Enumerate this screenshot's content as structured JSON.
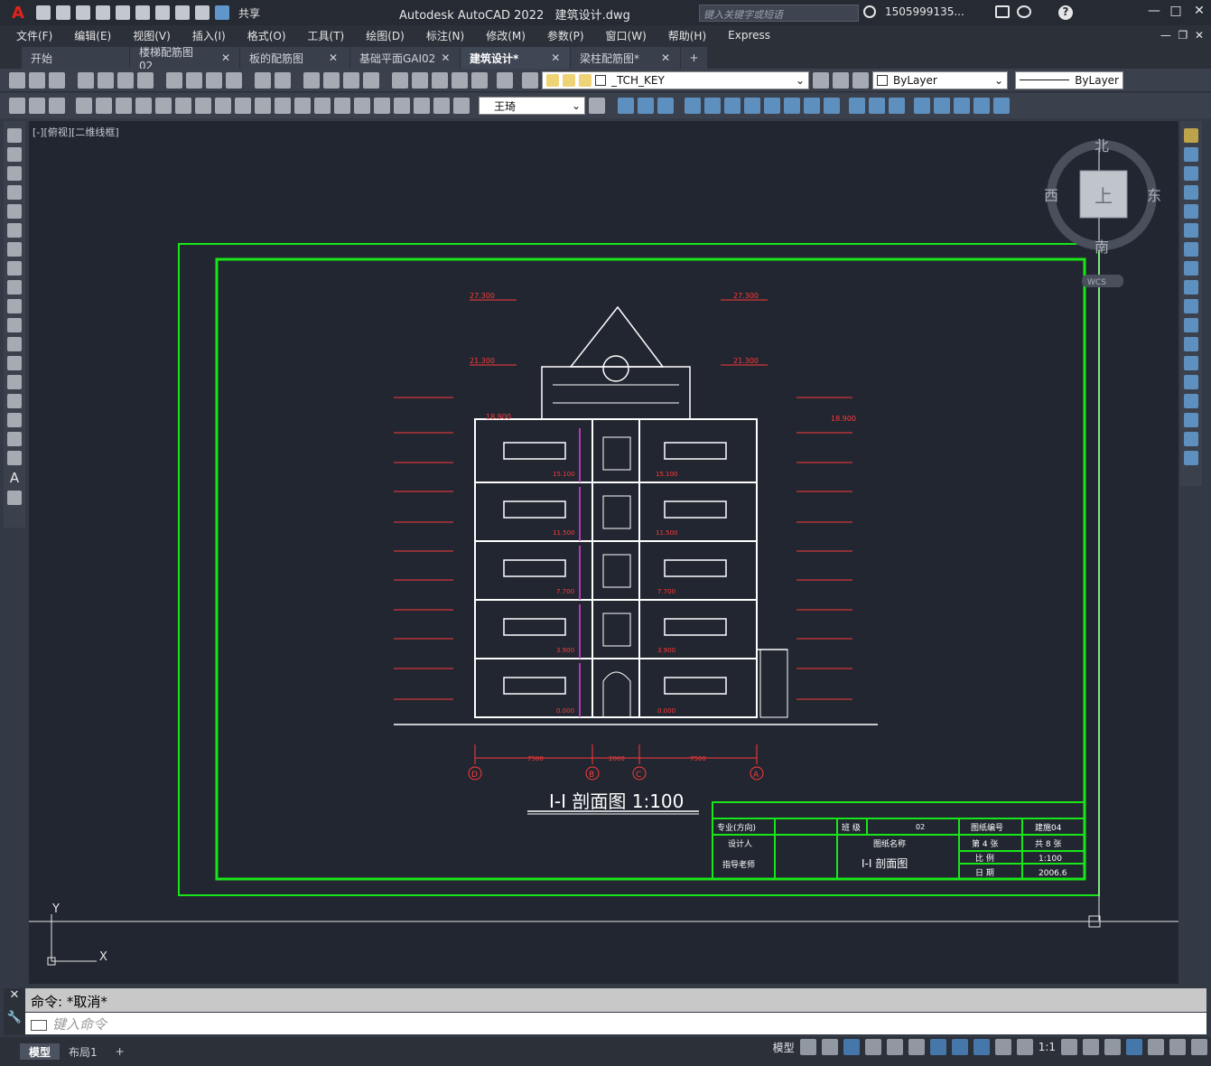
{
  "app": {
    "logo": "A",
    "title": "Autodesk AutoCAD 2022",
    "filename": "建筑设计.dwg",
    "share": "共享",
    "search_placeholder": "键入关键字或短语",
    "user": "1505999135...",
    "help": "?"
  },
  "menu": [
    "文件(F)",
    "编辑(E)",
    "视图(V)",
    "插入(I)",
    "格式(O)",
    "工具(T)",
    "绘图(D)",
    "标注(N)",
    "修改(M)",
    "参数(P)",
    "窗口(W)",
    "帮助(H)",
    "Express"
  ],
  "tabs": [
    {
      "label": "开始",
      "closable": false,
      "active": false
    },
    {
      "label": "楼梯配筋图02",
      "closable": true,
      "active": false
    },
    {
      "label": "板的配筋图",
      "closable": true,
      "active": false
    },
    {
      "label": "基础平面GAI02",
      "closable": true,
      "active": false
    },
    {
      "label": "建筑设计*",
      "closable": true,
      "active": true
    },
    {
      "label": "梁柱配筋图*",
      "closable": true,
      "active": false
    }
  ],
  "toolbar": {
    "layer": "_TCH_KEY",
    "color": "ByLayer",
    "linetype": "ByLayer",
    "textstyle": "王琦"
  },
  "viewport": {
    "label": "[-][俯视][二维线框]",
    "viewcube": {
      "north": "北",
      "south": "南",
      "east": "东",
      "west": "西",
      "top": "上",
      "wcs": "WCS"
    },
    "ucs": {
      "x": "X",
      "y": "Y"
    }
  },
  "drawing": {
    "title": "I-I  剖面图  1:100",
    "elevations_left": [
      "27.300",
      "21.300",
      "18.900"
    ],
    "elevations_right": [
      "27.300",
      "21.300",
      "18.900"
    ],
    "floor_levels": [
      "15.100",
      "11.500",
      "7.700",
      "3.900",
      "0.000"
    ],
    "right_levels": [
      "15.100",
      "11.500",
      "7.700",
      "3.900",
      "0.000"
    ],
    "axes": [
      "D",
      "B",
      "C",
      "A"
    ],
    "dims": [
      "7500",
      "2000",
      "7500"
    ],
    "titleblock": {
      "major_label": "专业(方向)",
      "class_label": "班 级",
      "class_value": "02",
      "drawing_no_label": "图纸编号",
      "drawing_no_value": "建施04",
      "designer_label": "设计人",
      "drawing_name_label": "图纸名称",
      "sheet_label": "第 4 张",
      "total_label": "共 8 张",
      "advisor_label": "指导老师",
      "drawing_name_value": "I-I 剖面图",
      "scale_label": "比 例",
      "scale_value": "1:100",
      "date_label": "日 期",
      "date_value": "2006.6"
    }
  },
  "command": {
    "history": "命令: *取消*",
    "placeholder": "键入命令"
  },
  "layout_tabs": [
    "模型",
    "布局1"
  ],
  "status": {
    "model": "模型",
    "scale": "1:1"
  }
}
